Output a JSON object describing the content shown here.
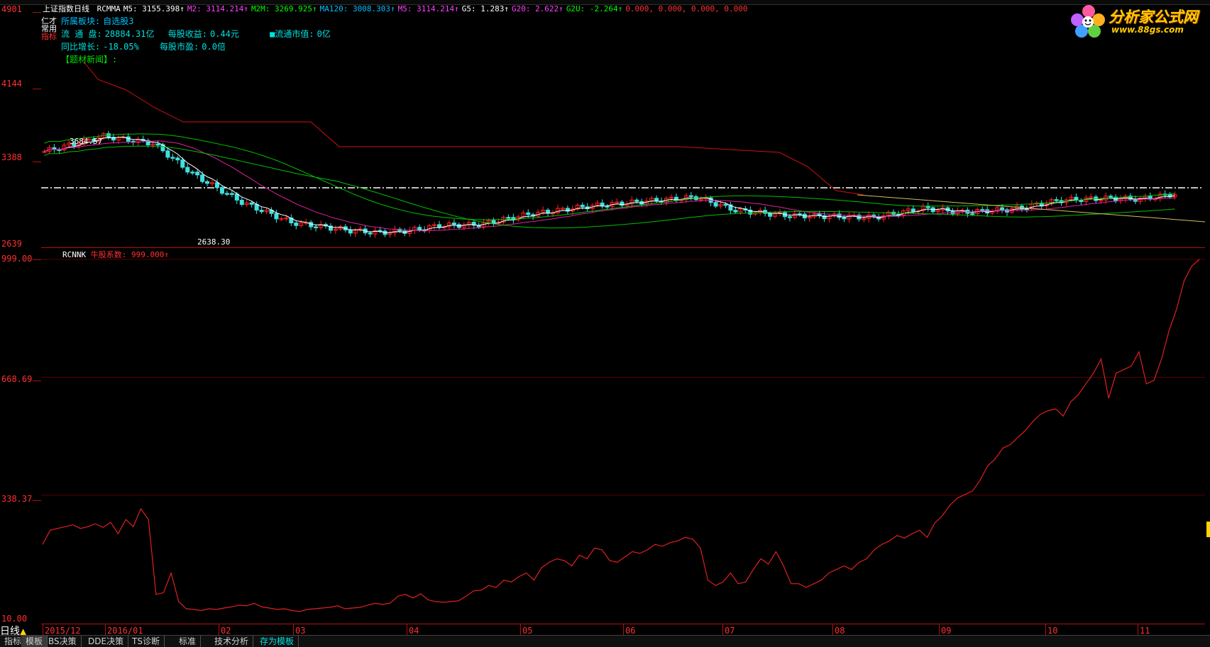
{
  "app": {
    "period": "日线",
    "period_marker": "▲"
  },
  "logo": {
    "title": "分析家公式网",
    "url": "www.88gs.com"
  },
  "price_header": {
    "title": "上证指数日线",
    "items": [
      {
        "text": "RCMMA",
        "color": "#ffffff"
      },
      {
        "text": "M5: 3155.398↑",
        "color": "#ffffff"
      },
      {
        "text": "M2: 3114.214↑",
        "color": "#ff40ff"
      },
      {
        "text": "M2M: 3269.925↑",
        "color": "#00ff00"
      },
      {
        "text": "MA120: 3008.303↑",
        "color": "#00c0ff"
      },
      {
        "text": "M5: 3114.214↑",
        "color": "#ff40ff"
      },
      {
        "text": "G5: 1.283↑",
        "color": "#ffffff"
      },
      {
        "text": "G20: 2.622↑",
        "color": "#ff40ff"
      },
      {
        "text": "G2U: -2.264↑",
        "color": "#00ff00"
      },
      {
        "text": "0.000, 0.000, 0.000, 0.000",
        "color": "#ff3030"
      }
    ]
  },
  "side_tags": [
    "仁才",
    "常用",
    "指标"
  ],
  "info": {
    "board_label": "所属板块:",
    "board_value": "自选股3",
    "float_shares_label": "流 通 盘:",
    "float_shares_value": "28884.31亿",
    "eps_label": "每股收益:",
    "eps_value": "0.44元",
    "mktcap_label": "流通市值:",
    "mktcap_value": "0亿",
    "yoy_label": "同比增长:",
    "yoy_value": "-18.05%",
    "pe_label": "每股市盈:",
    "pe_value": "0.0倍",
    "news_label": "【题材新闻】:"
  },
  "price_axis": {
    "labels": [
      "4901",
      "4144",
      "3388",
      "2639"
    ]
  },
  "indicator": {
    "name": "RCNNK",
    "value_text": "牛股系数: 999.000↑",
    "axis_labels": [
      "999.00",
      "668.69",
      "338.37",
      "10.00"
    ]
  },
  "price_annotations": {
    "high_label": "3684.57",
    "low_label": "2638.30"
  },
  "time_axis": {
    "labels": [
      "2015/12",
      "2016/01",
      "02",
      "03",
      "04",
      "05",
      "06",
      "07",
      "08",
      "09",
      "10",
      "11"
    ]
  },
  "bottom_tabs": [
    "指标",
    "模板",
    "BS决策",
    "DDE决策",
    "TS诊断",
    "标准",
    "技术分析",
    "存为模板"
  ],
  "colors": {
    "axis_red": "#ff3030",
    "up_candle": "#ff2020",
    "down_candle": "#40e0e0",
    "upper_band": "#d01010",
    "ma_green": "#00c000",
    "ma_magenta": "#e020a0",
    "ma_white": "#ffffff",
    "ma_yellow": "#d0c060",
    "indicator_line": "#e02020",
    "active_tab": "#00e0e0"
  },
  "chart_data": {
    "type": "line",
    "indicator": "RCNNK",
    "ylim": [
      10.0,
      999.0
    ],
    "values": [
      200,
      240,
      245,
      250,
      255,
      245,
      250,
      258,
      248,
      262,
      230,
      270,
      250,
      300,
      270,
      60,
      65,
      120,
      40,
      20,
      18,
      15,
      20,
      18,
      22,
      25,
      30,
      28,
      35,
      25,
      22,
      18,
      20,
      15,
      12,
      18,
      20,
      22,
      24,
      28,
      20,
      22,
      24,
      30,
      35,
      32,
      36,
      55,
      60,
      50,
      62,
      45,
      40,
      38,
      40,
      42,
      55,
      70,
      72,
      85,
      80,
      100,
      95,
      110,
      120,
      100,
      135,
      150,
      160,
      155,
      140,
      170,
      160,
      190,
      185,
      155,
      150,
      165,
      180,
      175,
      185,
      200,
      195,
      205,
      210,
      220,
      215,
      190,
      100,
      85,
      95,
      120,
      90,
      95,
      130,
      160,
      145,
      180,
      140,
      90,
      90,
      80,
      90,
      100,
      120,
      130,
      140,
      130,
      150,
      160,
      185,
      200,
      210,
      225,
      218,
      230,
      240,
      220,
      260,
      280,
      310,
      330,
      340,
      350,
      380,
      420,
      440,
      470,
      480,
      500,
      520,
      545,
      565,
      575,
      580,
      560,
      600,
      620,
      650,
      680,
      720,
      610,
      680,
      690,
      700,
      740,
      650,
      660,
      720,
      800,
      860,
      940,
      980,
      999
    ]
  }
}
